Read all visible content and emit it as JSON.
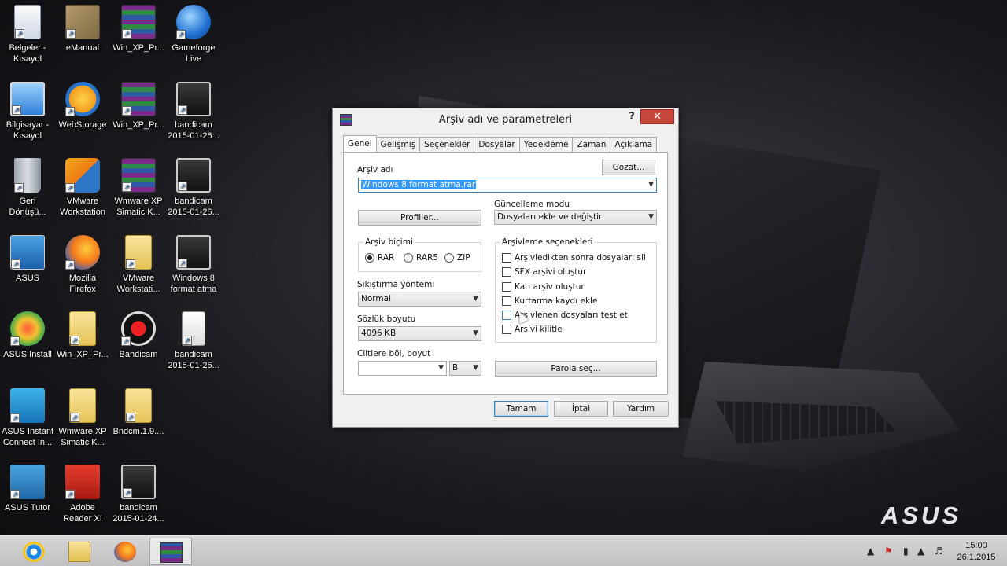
{
  "desktop": {
    "icons": [
      {
        "label": "Belgeler - Kısayol",
        "icon": "documents-icon"
      },
      {
        "label": "eManual",
        "icon": "book-icon"
      },
      {
        "label": "Win_XP_Pr...",
        "icon": "winrar-archive-icon"
      },
      {
        "label": "Gameforge Live",
        "icon": "gameforge-globe-icon"
      },
      {
        "label": "Bilgisayar - Kısayol",
        "icon": "computer-icon"
      },
      {
        "label": "WebStorage",
        "icon": "webstorage-icon"
      },
      {
        "label": "Win_XP_Pr...",
        "icon": "winrar-archive-icon"
      },
      {
        "label": "bandicam 2015-01-26...",
        "icon": "video-file-icon"
      },
      {
        "label": "Geri Dönüşü...",
        "icon": "recycle-bin-icon"
      },
      {
        "label": "VMware Workstation",
        "icon": "vmware-icon"
      },
      {
        "label": "Wmware XP Simatic K...",
        "icon": "winrar-archive-icon"
      },
      {
        "label": "bandicam 2015-01-26...",
        "icon": "video-file-icon"
      },
      {
        "label": "ASUS",
        "icon": "asus-folder-icon"
      },
      {
        "label": "Mozilla Firefox",
        "icon": "firefox-icon"
      },
      {
        "label": "VMware Workstati...",
        "icon": "folder-icon"
      },
      {
        "label": "Windows 8 format atma",
        "icon": "video-file-icon"
      },
      {
        "label": "ASUS Install",
        "icon": "asus-install-icon"
      },
      {
        "label": "Win_XP_Pr...",
        "icon": "folder-icon"
      },
      {
        "label": "Bandicam",
        "icon": "bandicam-icon"
      },
      {
        "label": "bandicam 2015-01-26...",
        "icon": "avi-file-icon"
      },
      {
        "label": "ASUS Instant Connect In...",
        "icon": "asus-instant-connect-icon"
      },
      {
        "label": "Wmware XP Simatic K...",
        "icon": "folder-icon"
      },
      {
        "label": "Bndcm.1.9....",
        "icon": "zip-folder-icon"
      },
      {
        "label": "ASUS Tutor",
        "icon": "asus-tutor-icon"
      },
      {
        "label": "Adobe Reader XI",
        "icon": "adobe-reader-icon"
      },
      {
        "label": "bandicam 2015-01-24...",
        "icon": "video-file-icon"
      }
    ]
  },
  "wallpaper": {
    "brand": "ASUS"
  },
  "dialog": {
    "title": "Arşiv adı ve parametreleri",
    "help": "?",
    "close": "✕",
    "tabs": [
      "Genel",
      "Gelişmiş",
      "Seçenekler",
      "Dosyalar",
      "Yedekleme",
      "Zaman",
      "Açıklama"
    ],
    "active_tab": "Genel",
    "archive_name_label": "Arşiv adı",
    "browse_button": "Gözat...",
    "archive_name_value": "Windows 8 format atma.rar",
    "profiles_button": "Profiller...",
    "update_mode_label": "Güncelleme modu",
    "update_mode_value": "Dosyaları ekle ve değiştir",
    "archive_format_label": "Arşiv biçimi",
    "formats": [
      "RAR",
      "RAR5",
      "ZIP"
    ],
    "selected_format": "RAR",
    "compression_label": "Sıkıştırma yöntemi",
    "compression_value": "Normal",
    "dictionary_label": "Sözlük boyutu",
    "dictionary_value": "4096 KB",
    "split_label": "Ciltlere böl, boyut",
    "split_value": "",
    "split_unit": "B",
    "archiving_options_label": "Arşivleme seçenekleri",
    "options": [
      {
        "label": "Arşivledikten sonra dosyaları sil",
        "checked": false
      },
      {
        "label": "SFX arşivi oluştur",
        "checked": false
      },
      {
        "label": "Katı arşiv oluştur",
        "checked": false
      },
      {
        "label": "Kurtarma kaydı ekle",
        "checked": false
      },
      {
        "label": "Arşivlenen dosyaları test et",
        "checked": false
      },
      {
        "label": "Arşivi kilitle",
        "checked": false
      }
    ],
    "password_button": "Parola seç...",
    "ok_button": "Tamam",
    "cancel_button": "İptal",
    "help_button": "Yardım"
  },
  "taskbar": {
    "pinned": [
      {
        "icon": "internet-explorer-icon",
        "active": false
      },
      {
        "icon": "file-explorer-icon",
        "active": false
      },
      {
        "icon": "firefox-icon",
        "active": false
      },
      {
        "icon": "winrar-icon",
        "active": true
      }
    ],
    "tray": {
      "time": "15:00",
      "date": "26.1.2015"
    }
  }
}
